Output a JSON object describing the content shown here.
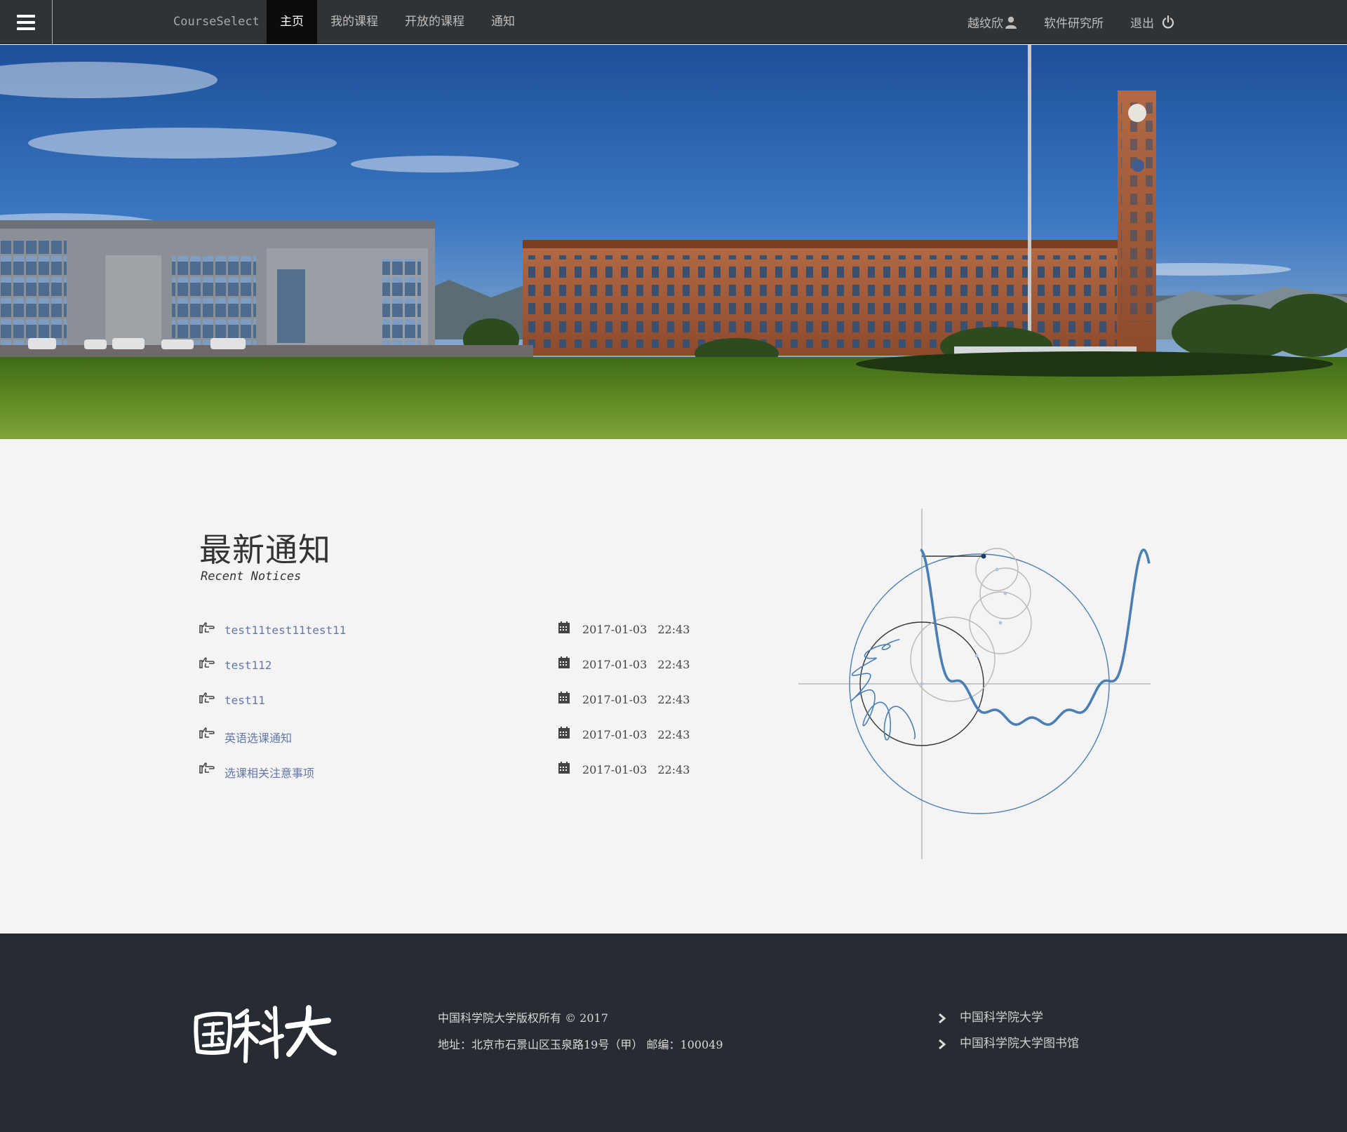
{
  "navbar": {
    "brand": "CourseSelect",
    "links": [
      {
        "label": "主页",
        "active": true
      },
      {
        "label": "我的课程",
        "active": false
      },
      {
        "label": "开放的课程",
        "active": false
      },
      {
        "label": "通知",
        "active": false
      }
    ],
    "user_name": "越纹欣",
    "user_icon": "user-icon",
    "institute": "软件研究所",
    "logout_label": "退出",
    "logout_icon": "power-icon",
    "menu_icon": "hamburger-icon"
  },
  "hero": {
    "image": "campus-banner"
  },
  "notices": {
    "title": "最新通知",
    "subtitle": "Recent Notices",
    "items": [
      {
        "title": "test11test11test11",
        "date": "2017-01-03",
        "time": "22:43"
      },
      {
        "title": "test112",
        "date": "2017-01-03",
        "time": "22:43"
      },
      {
        "title": "test11",
        "date": "2017-01-03",
        "time": "22:43"
      },
      {
        "title": "英语选课通知",
        "date": "2017-01-03",
        "time": "22:43"
      },
      {
        "title": "选课相关注意事项",
        "date": "2017-01-03",
        "time": "22:43"
      }
    ],
    "item_icon": "hand-point-right-icon",
    "date_icon": "calendar-icon"
  },
  "illustration": {
    "name": "fourier-series-animation",
    "wave_color": "#4a7fb5",
    "axis_color": "#c8c8c8"
  },
  "footer": {
    "logo_text": "国科大",
    "copyright": "中国科学院大学版权所有 © 2017",
    "address": "地址：北京市石景山区玉泉路19号（甲） 邮编：100049",
    "links": [
      {
        "label": "中国科学院大学"
      },
      {
        "label": "中国科学院大学图书馆"
      }
    ],
    "link_icon": "chevron-right-icon"
  },
  "colors": {
    "navbar_bg": "#303336",
    "active_tab_bg": "#0c0c0c",
    "notice_link": "#6677a8",
    "footer_bg": "#272b32",
    "page_bg": "#f4f4f4"
  }
}
